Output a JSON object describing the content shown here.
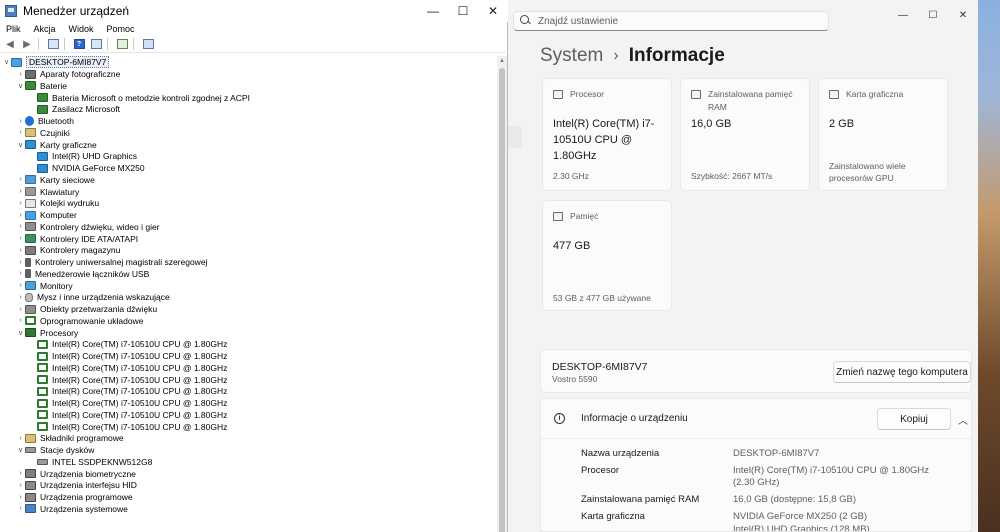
{
  "device_manager": {
    "title": "Menedżer urządzeń",
    "menu": [
      "Plik",
      "Akcja",
      "Widok",
      "Pomoc"
    ],
    "root": "DESKTOP-6MI87V7",
    "tree": [
      {
        "label": "Aparaty fotograficzne",
        "level": 1,
        "expander": ">",
        "icon": "camera-icon"
      },
      {
        "label": "Baterie",
        "level": 1,
        "expander": "v",
        "icon": "battery-icon"
      },
      {
        "label": "Bateria Microsoft o metodzie kontroli zgodnej z ACPI",
        "level": 2,
        "expander": "",
        "icon": "battery-icon"
      },
      {
        "label": "Zasilacz Microsoft",
        "level": 2,
        "expander": "",
        "icon": "battery-icon"
      },
      {
        "label": "Bluetooth",
        "level": 1,
        "expander": ">",
        "icon": "bluetooth-icon"
      },
      {
        "label": "Czujniki",
        "level": 1,
        "expander": ">",
        "icon": "sensor-icon"
      },
      {
        "label": "Karty graficzne",
        "level": 1,
        "expander": "v",
        "icon": "display-adapter-icon"
      },
      {
        "label": "Intel(R) UHD Graphics",
        "level": 2,
        "expander": "",
        "icon": "display-adapter-icon"
      },
      {
        "label": "NVIDIA GeForce MX250",
        "level": 2,
        "expander": "",
        "icon": "display-adapter-icon"
      },
      {
        "label": "Karty sieciowe",
        "level": 1,
        "expander": ">",
        "icon": "network-icon"
      },
      {
        "label": "Klawiatury",
        "level": 1,
        "expander": ">",
        "icon": "keyboard-icon"
      },
      {
        "label": "Kolejki wydruku",
        "level": 1,
        "expander": ">",
        "icon": "printer-icon"
      },
      {
        "label": "Komputer",
        "level": 1,
        "expander": ">",
        "icon": "computer-icon"
      },
      {
        "label": "Kontrolery dźwięku, wideo i gier",
        "level": 1,
        "expander": ">",
        "icon": "sound-icon"
      },
      {
        "label": "Kontrolery IDE ATA/ATAPI",
        "level": 1,
        "expander": ">",
        "icon": "ide-icon"
      },
      {
        "label": "Kontrolery magazynu",
        "level": 1,
        "expander": ">",
        "icon": "storage-icon"
      },
      {
        "label": "Kontrolery uniwersalnej magistrali szeregowej",
        "level": 1,
        "expander": ">",
        "icon": "usb-icon"
      },
      {
        "label": "Menedżerowie łączników USB",
        "level": 1,
        "expander": ">",
        "icon": "usb-icon"
      },
      {
        "label": "Monitory",
        "level": 1,
        "expander": ">",
        "icon": "monitor-icon"
      },
      {
        "label": "Mysz i inne urządzenia wskazujące",
        "level": 1,
        "expander": ">",
        "icon": "mouse-icon"
      },
      {
        "label": "Obiekty przetwarzania dźwięku",
        "level": 1,
        "expander": ">",
        "icon": "sound-icon"
      },
      {
        "label": "Oprogramowanie układowe",
        "level": 1,
        "expander": ">",
        "icon": "firmware-icon"
      },
      {
        "label": "Procesory",
        "level": 1,
        "expander": "v",
        "icon": "cpu-icon"
      },
      {
        "label": "Intel(R) Core(TM) i7-10510U CPU @ 1.80GHz",
        "level": 2,
        "expander": "",
        "icon": "cpu-icon"
      },
      {
        "label": "Intel(R) Core(TM) i7-10510U CPU @ 1.80GHz",
        "level": 2,
        "expander": "",
        "icon": "cpu-icon"
      },
      {
        "label": "Intel(R) Core(TM) i7-10510U CPU @ 1.80GHz",
        "level": 2,
        "expander": "",
        "icon": "cpu-icon"
      },
      {
        "label": "Intel(R) Core(TM) i7-10510U CPU @ 1.80GHz",
        "level": 2,
        "expander": "",
        "icon": "cpu-icon"
      },
      {
        "label": "Intel(R) Core(TM) i7-10510U CPU @ 1.80GHz",
        "level": 2,
        "expander": "",
        "icon": "cpu-icon"
      },
      {
        "label": "Intel(R) Core(TM) i7-10510U CPU @ 1.80GHz",
        "level": 2,
        "expander": "",
        "icon": "cpu-icon"
      },
      {
        "label": "Intel(R) Core(TM) i7-10510U CPU @ 1.80GHz",
        "level": 2,
        "expander": "",
        "icon": "cpu-icon"
      },
      {
        "label": "Intel(R) Core(TM) i7-10510U CPU @ 1.80GHz",
        "level": 2,
        "expander": "",
        "icon": "cpu-icon"
      },
      {
        "label": "Składniki programowe",
        "level": 1,
        "expander": ">",
        "icon": "software-icon"
      },
      {
        "label": "Stacje dysków",
        "level": 1,
        "expander": "v",
        "icon": "disk-icon"
      },
      {
        "label": "INTEL SSDPEKNW512G8",
        "level": 2,
        "expander": "",
        "icon": "disk-icon"
      },
      {
        "label": "Urządzenia biometryczne",
        "level": 1,
        "expander": ">",
        "icon": "biometric-icon"
      },
      {
        "label": "Urządzenia interfejsu HID",
        "level": 1,
        "expander": ">",
        "icon": "hid-icon"
      },
      {
        "label": "Urządzenia programowe",
        "level": 1,
        "expander": ">",
        "icon": "software-device-icon"
      },
      {
        "label": "Urządzenia systemowe",
        "level": 1,
        "expander": ">",
        "icon": "system-device-icon"
      }
    ]
  },
  "settings": {
    "search_placeholder": "Znajdź ustawienie",
    "breadcrumb_parent": "System",
    "breadcrumb_current": "Informacje",
    "cards": [
      {
        "label": "Procesor",
        "value": "Intel(R) Core(TM) i7-10510U CPU @ 1.80GHz",
        "sub": "2.30 GHz",
        "icon": "cpu-icon"
      },
      {
        "label": "Zainstalowana pamięć RAM",
        "value": "16,0 GB",
        "sub": "Szybkość: 2667 MT/s",
        "icon": "ram-icon"
      },
      {
        "label": "Karta graficzna",
        "value": "2 GB",
        "sub": "Zainstalowano wiele procesorów GPU",
        "icon": "gpu-icon"
      },
      {
        "label": "Pamięć",
        "value": "477 GB",
        "sub": "53 GB z 477 GB używane",
        "icon": "storage-icon"
      }
    ],
    "device": {
      "name": "DESKTOP-6MI87V7",
      "model": "Vostro 5590",
      "rename_label": "Zmień nazwę tego komputera"
    },
    "info": {
      "title": "Informacje o urządzeniu",
      "copy_label": "Kopiuj",
      "specs": [
        {
          "label": "Nazwa urządzenia",
          "value": "DESKTOP-6MI87V7"
        },
        {
          "label": "Procesor",
          "value": "Intel(R) Core(TM) i7-10510U CPU @ 1.80GHz (2.30 GHz)"
        },
        {
          "label": "Zainstalowana pamięć RAM",
          "value": "16,0 GB (dostępne: 15,8 GB)"
        },
        {
          "label": "Karta graficzna",
          "value": "NVIDIA GeForce MX250 (2 GB)"
        },
        {
          "label": "",
          "value": "Intel(R) UHD Graphics (128 MB)"
        }
      ]
    }
  }
}
